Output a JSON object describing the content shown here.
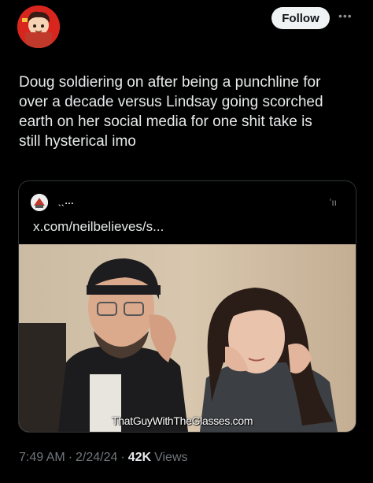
{
  "header": {
    "follow_label": "Follow",
    "more_icon": "more-horizontal-icon"
  },
  "tweet": {
    "text": "Doug soldiering on after being a punchline for\nover a decade versus Lindsay going scorched\nearth on her social media for one shit take is\nstill hysterical imo"
  },
  "quoted_card": {
    "name": "ˎˎ…",
    "right_text": "ʼıı",
    "url": "x.com/neilbeliеves/s...",
    "watermark": "ThatGuyWithTheGlasses.com"
  },
  "meta": {
    "time": "7:49 AM",
    "sep1": "·",
    "date": "2/24/24",
    "sep2": "·",
    "views_count": "42K",
    "views_label": "Views"
  },
  "colors": {
    "background": "#000000",
    "text": "#e7e9ea",
    "muted": "#71767b",
    "follow_bg": "#eff3f4",
    "border": "#2f3336"
  }
}
